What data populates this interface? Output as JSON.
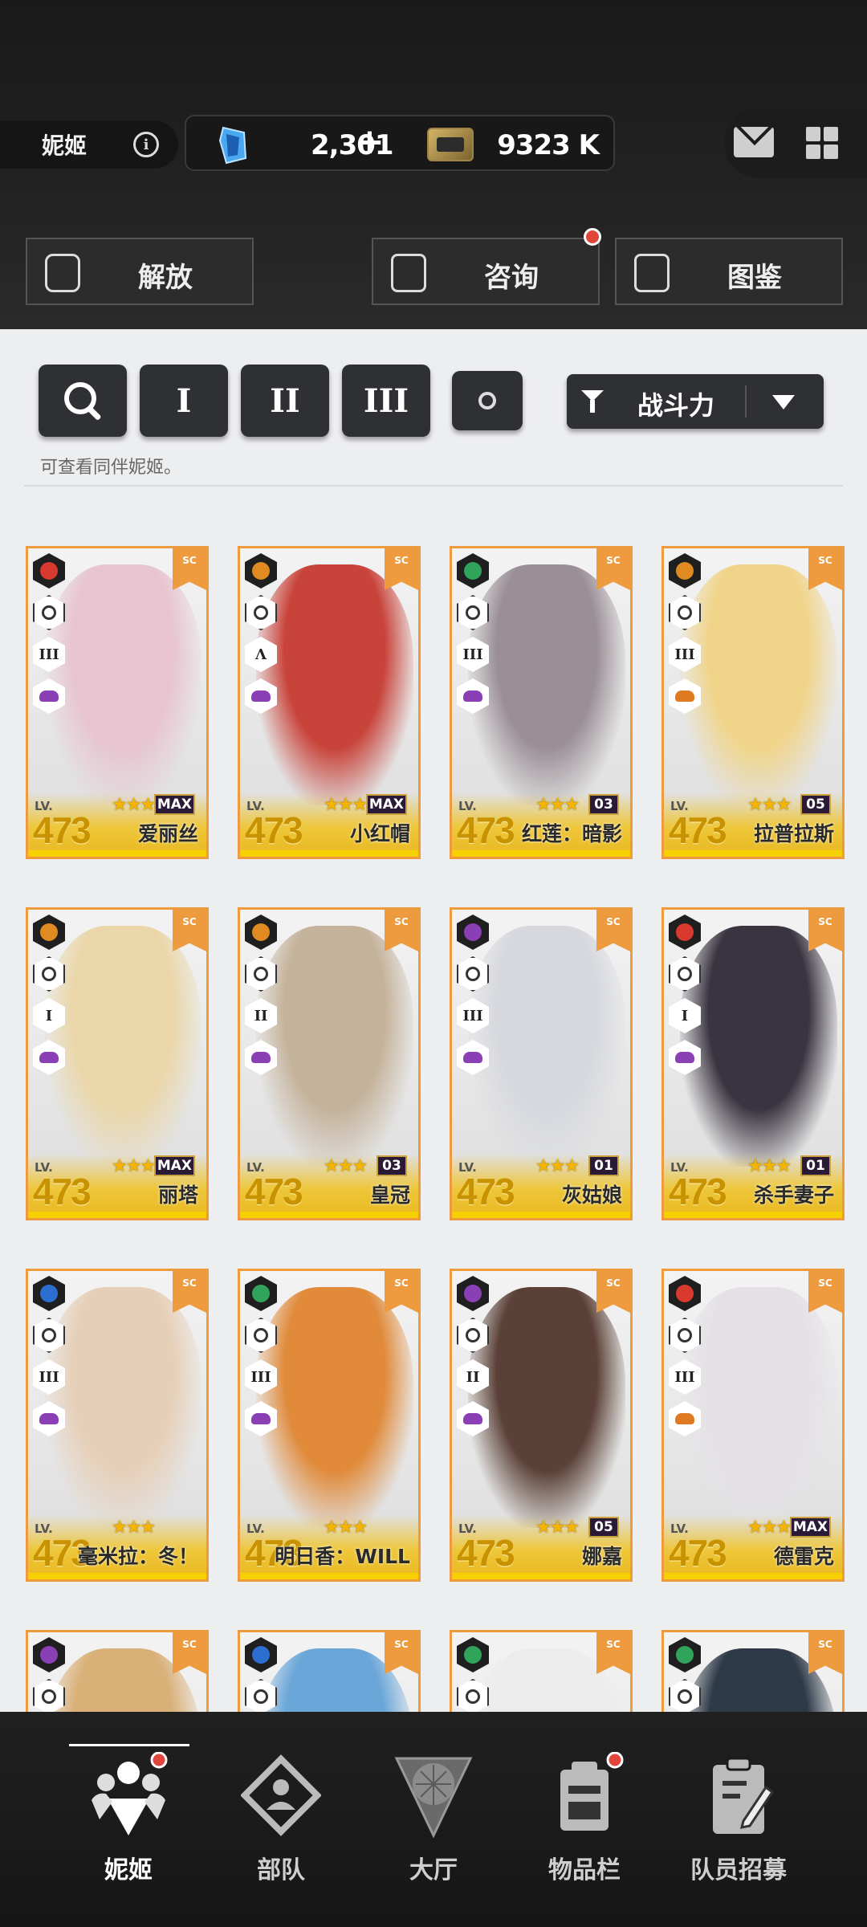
{
  "header": {
    "title": "妮姬",
    "gems": "2,301",
    "gems_plus": "+",
    "credits": "9323 K"
  },
  "actions": {
    "release": "解放",
    "consult": "咨询",
    "codex": "图鉴"
  },
  "filters": {
    "burst1": "I",
    "burst2": "II",
    "burst3": "III",
    "sort_label": "战斗力",
    "hint": "可查看同伴妮姬。"
  },
  "card_common": {
    "lv_label": "LV.",
    "sc": "SC",
    "stars": "★★★"
  },
  "cards": [
    {
      "name": "爱丽丝",
      "level": "473",
      "rank": "MAX",
      "burst": "III",
      "element": "#d93a2f",
      "class_color": "#8a3fb5",
      "portrait": "#e7c4cf"
    },
    {
      "name": "小红帽",
      "level": "473",
      "rank": "MAX",
      "burst": "Λ",
      "element": "#e08a22",
      "class_color": "#8a3fb5",
      "portrait": "#c8433a"
    },
    {
      "name": "红莲：暗影",
      "level": "473",
      "rank": "03",
      "burst": "III",
      "element": "#2fa45a",
      "class_color": "#8a3fb5",
      "portrait": "#9a8f96"
    },
    {
      "name": "拉普拉斯",
      "level": "473",
      "rank": "05",
      "burst": "III",
      "element": "#e08a22",
      "class_color": "#e07a22",
      "portrait": "#f0d48a"
    },
    {
      "name": "丽塔",
      "level": "473",
      "rank": "MAX",
      "burst": "I",
      "element": "#e08a22",
      "class_color": "#8a3fb5",
      "portrait": "#ead6a8"
    },
    {
      "name": "皇冠",
      "level": "473",
      "rank": "03",
      "burst": "II",
      "element": "#e08a22",
      "class_color": "#8a3fb5",
      "portrait": "#c4b29a"
    },
    {
      "name": "灰姑娘",
      "level": "473",
      "rank": "01",
      "burst": "III",
      "element": "#8a3fb5",
      "class_color": "#8a3fb5",
      "portrait": "#d6d8de"
    },
    {
      "name": "杀手妻子",
      "level": "473",
      "rank": "01",
      "burst": "I",
      "element": "#d93a2f",
      "class_color": "#8a3fb5",
      "portrait": "#3a3440"
    },
    {
      "name": "毫米拉：冬！",
      "level": "473",
      "rank": "",
      "burst": "III",
      "element": "#2d6fd1",
      "class_color": "#8a3fb5",
      "portrait": "#e6cfb8"
    },
    {
      "name": "明日香：WILL",
      "level": "473",
      "rank": "",
      "burst": "III",
      "element": "#2fa45a",
      "class_color": "#8a3fb5",
      "portrait": "#e08a3a"
    },
    {
      "name": "娜嘉",
      "level": "473",
      "rank": "05",
      "burst": "II",
      "element": "#8a3fb5",
      "class_color": "#8a3fb5",
      "portrait": "#5a4036"
    },
    {
      "name": "德雷克",
      "level": "473",
      "rank": "MAX",
      "burst": "III",
      "element": "#d93a2f",
      "class_color": "#e07a22",
      "portrait": "#e4e0e6"
    },
    {
      "name": "",
      "level": "",
      "rank": "",
      "burst": "",
      "element": "#8a3fb5",
      "class_color": "#8a3fb5",
      "portrait": "#d9b077"
    },
    {
      "name": "",
      "level": "",
      "rank": "",
      "burst": "",
      "element": "#2d6fd1",
      "class_color": "#8a3fb5",
      "portrait": "#6aa6d8"
    },
    {
      "name": "",
      "level": "",
      "rank": "",
      "burst": "",
      "element": "#2fa45a",
      "class_color": "#8a3fb5",
      "portrait": "#ececec"
    },
    {
      "name": "",
      "level": "",
      "rank": "",
      "burst": "",
      "element": "#2fa45a",
      "class_color": "#8a3fb5",
      "portrait": "#2e3a48"
    }
  ],
  "nav": {
    "nikke": "妮姬",
    "squad": "部队",
    "lobby": "大厅",
    "inventory": "物品栏",
    "recruit": "队员招募"
  }
}
